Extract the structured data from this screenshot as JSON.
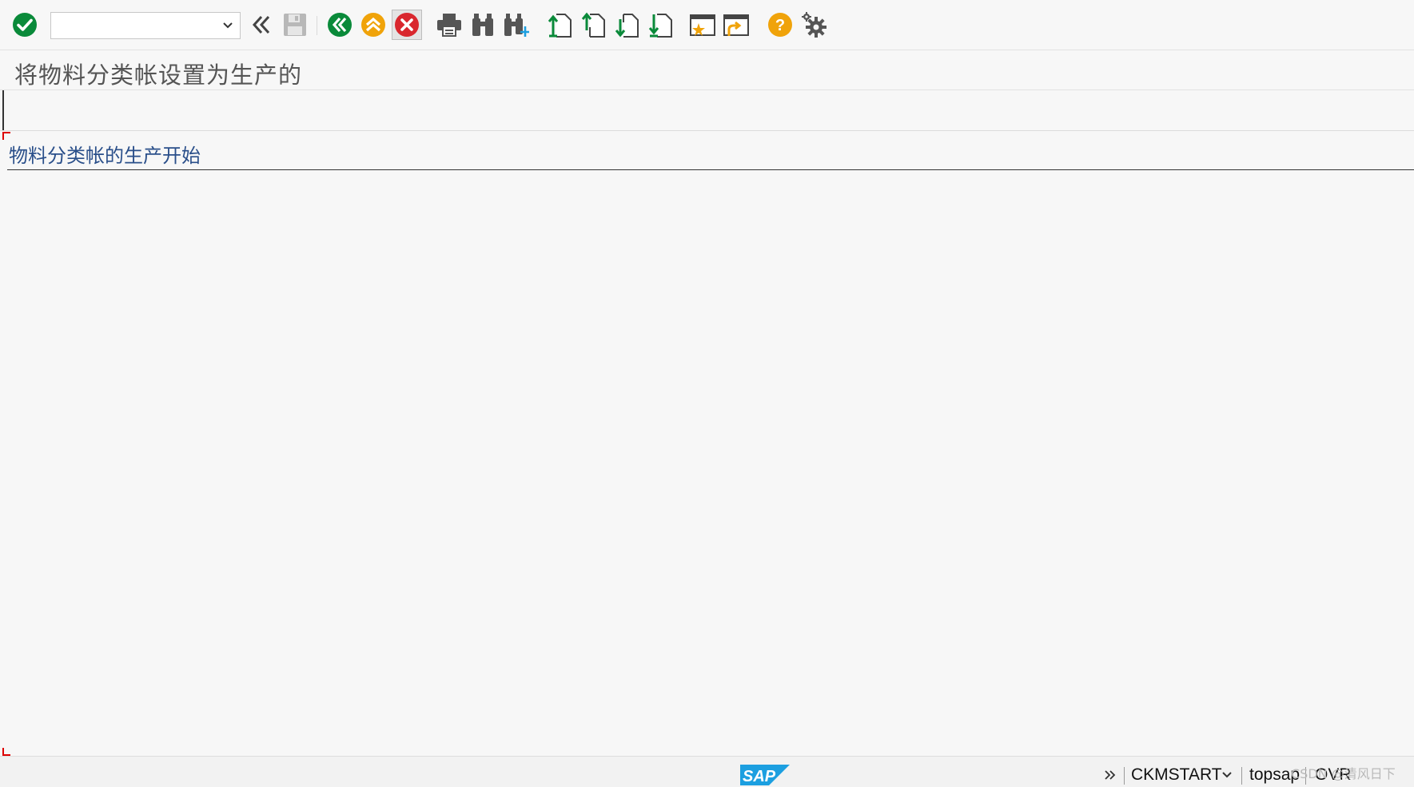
{
  "toolbar": {
    "command_field_value": "",
    "command_field_placeholder": "",
    "icons": [
      "enter-icon",
      "command-dropdown-icon",
      "collapse-icon",
      "save-icon",
      "back-icon",
      "exit-icon",
      "cancel-icon",
      "print-icon",
      "find-icon",
      "find-next-icon",
      "first-page-icon",
      "previous-page-icon",
      "next-page-icon",
      "last-page-icon",
      "create-session-icon",
      "create-shortcut-icon",
      "help-icon",
      "settings-icon"
    ]
  },
  "title": "将物料分类帐设置为生产的",
  "content": {
    "heading": "物料分类帐的生产开始"
  },
  "statusbar": {
    "logo": "SAP",
    "transaction": "CKMSTART",
    "user": "topsap",
    "mode": "OVR",
    "watermark": "CSDN @清风日下"
  },
  "colors": {
    "green": "#0a8a3a",
    "orange": "#f0a30a",
    "red": "#d9272e",
    "sap_blue": "#1c9fe0",
    "heading_blue": "#2a4f8a"
  }
}
